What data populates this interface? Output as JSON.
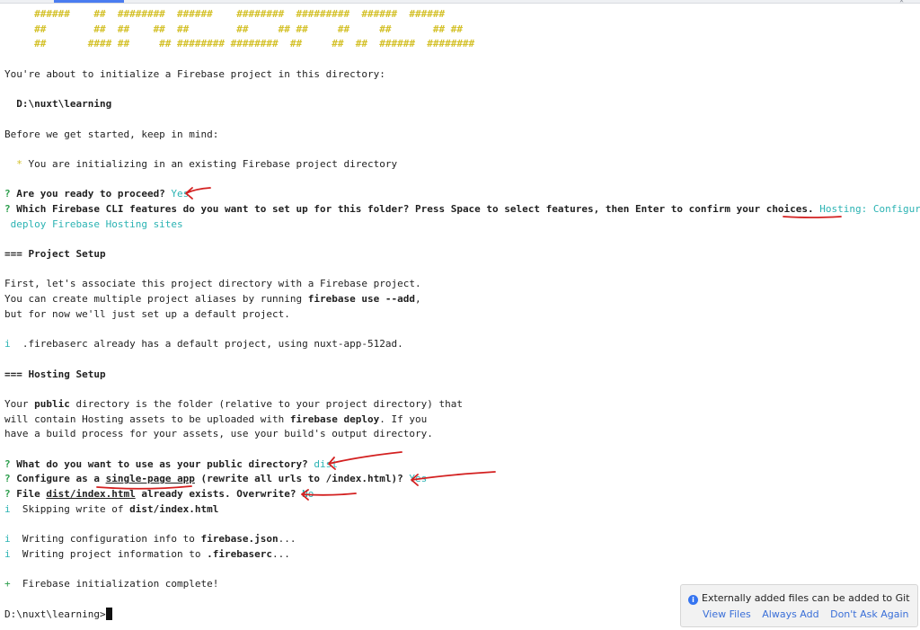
{
  "banner": [
    "     ######    ##  ########  ######    ########  #########  ######  ######",
    "     ##        ##  ##    ##  ##        ##     ## ##     ##     ##       ## ##",
    "     ##       #### ##     ## ######## ########  ##     ##  ##  ######  ########"
  ],
  "terminal": {
    "intro": "You're about to initialize a Firebase project in this directory:",
    "project_dir": "  D:\\nuxt\\learning",
    "keep_in_mind": "Before we get started, keep in mind:",
    "warn_mark": "  *",
    "warn_text": " You are initializing in an existing Firebase project directory",
    "q_mark": "?",
    "q1": " Are you ready to proceed?",
    "a1": " Yes",
    "q2": " Which Firebase CLI features do you want to set up for this folder? Press Space to select features, then Enter to confirm your choices.",
    "a2_line1": " Hosting: Configure and",
    "a2_line2": " deploy Firebase Hosting sites",
    "section_project": "=== Project Setup",
    "p1": "First, let's associate this project directory with a Firebase project.",
    "p2_pre": "You can create multiple project aliases by running ",
    "p2_cmd": "firebase use --add",
    "p2_post": ",",
    "p3": "but for now we'll just set up a default project.",
    "info_mark": "i",
    "i1": "  .firebaserc already has a default project, using nuxt-app-512ad.",
    "section_hosting": "=== Hosting Setup",
    "h1_pre": "Your ",
    "h1_bold": "public",
    "h1_post": " directory is the folder (relative to your project directory) that",
    "h2_pre": "will contain Hosting assets to be uploaded with ",
    "h2_bold": "firebase deploy",
    "h2_post": ". If you",
    "h3": "have a build process for your assets, use your build's output directory.",
    "q3": " What do you want to use as your public directory?",
    "a3": " dist",
    "q4_pre": " Configure as a ",
    "q4_ul": "single-page app",
    "q4_post": " (rewrite all urls to /index.html)?",
    "a4": " Yes",
    "q5_pre": " File ",
    "q5_ul": "dist/index.html",
    "q5_post": " already exists. Overwrite?",
    "a5": " No",
    "i2_pre": "  Skipping write of ",
    "i2_bold": "dist/index.html",
    "i3_pre": "  Writing configuration info to ",
    "i3_bold": "firebase.json",
    "i3_post": "...",
    "i4_pre": "  Writing project information to ",
    "i4_bold": ".firebaserc",
    "i4_post": "...",
    "ok_mark": "+",
    "done": "  Firebase initialization complete!",
    "prompt": "D:\\nuxt\\learning>"
  },
  "notification": {
    "icon": "info-icon",
    "message": "Externally added files can be added to Git",
    "actions": [
      "View Files",
      "Always Add",
      "Don't Ask Again"
    ]
  },
  "colors": {
    "question": "#2a9d4a",
    "answer": "#2bb3b3",
    "banner": "#d4c12a",
    "annotation": "#d32020",
    "link": "#3a6fd8"
  }
}
